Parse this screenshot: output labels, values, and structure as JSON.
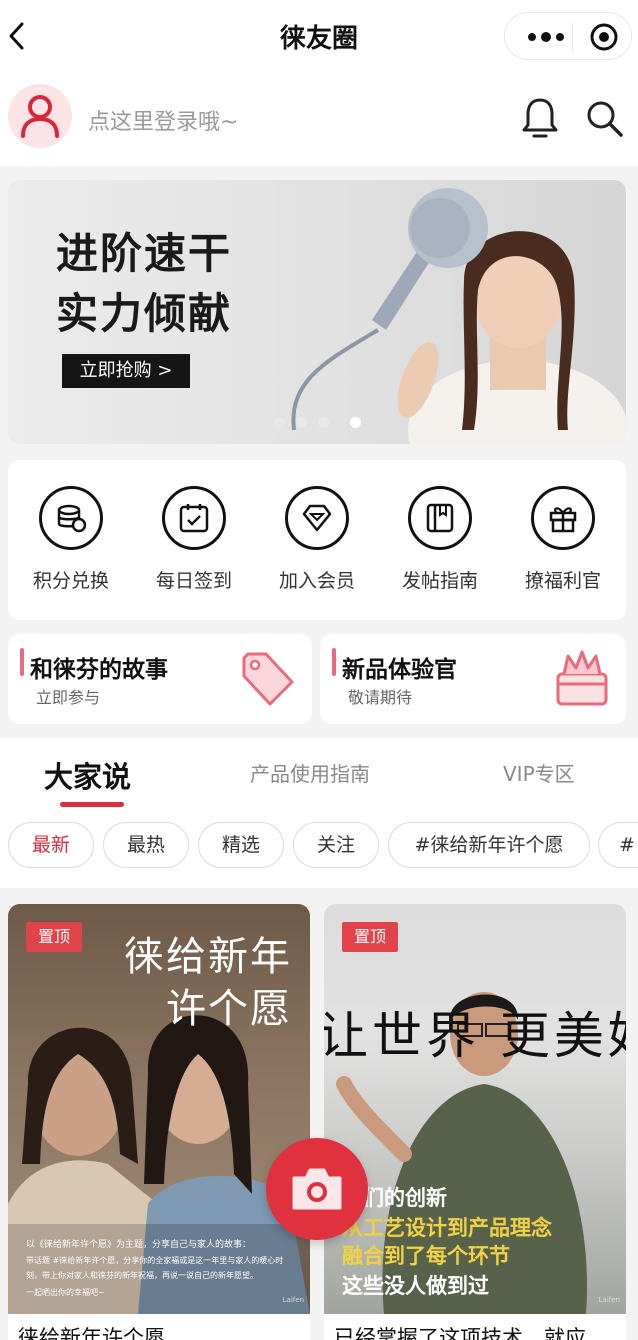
{
  "nav": {
    "title": "徕友圈",
    "back_icon": "back-arrow-icon",
    "more_icon": "more-dots-icon",
    "target_icon": "target-icon"
  },
  "user": {
    "login_prompt": "点这里登录哦~",
    "avatar_icon": "user-icon",
    "bell_icon": "bell-icon",
    "search_icon": "search-icon"
  },
  "banner": {
    "line1": "进阶速干",
    "line2": "实力倾献",
    "cta": "立即抢购 >",
    "slide_count": 4,
    "active_slide": 4
  },
  "quick_actions": [
    {
      "label": "积分兑换",
      "icon": "coins-icon"
    },
    {
      "label": "每日签到",
      "icon": "checkin-calendar-icon"
    },
    {
      "label": "加入会员",
      "icon": "diamond-icon"
    },
    {
      "label": "发帖指南",
      "icon": "book-icon"
    },
    {
      "label": "撩福利官",
      "icon": "gift-icon"
    }
  ],
  "promo_cards": [
    {
      "title": "和徕芬的故事",
      "subtitle": "立即参与",
      "icon": "tag-icon"
    },
    {
      "title": "新品体验官",
      "subtitle": "敬请期待",
      "icon": "gift-box-icon"
    }
  ],
  "tabs": [
    {
      "label": "大家说",
      "active": true
    },
    {
      "label": "产品使用指南",
      "active": false
    },
    {
      "label": "VIP专区",
      "active": false
    }
  ],
  "chips": [
    {
      "label": "最新",
      "active": true
    },
    {
      "label": "最热",
      "active": false
    },
    {
      "label": "精选",
      "active": false
    },
    {
      "label": "关注",
      "active": false
    },
    {
      "label": "#徕给新年许个愿",
      "active": false
    },
    {
      "label": "#",
      "active": false
    }
  ],
  "posts": [
    {
      "pin": "置顶",
      "headline_1": "徕给新年",
      "headline_2": "许个愿",
      "desc_1": "以《徕给新年许个愿》为主题，分享自己与家人的故事：",
      "desc_2": "带话题 #徕给新年许个愿，分享你的全家福或是这一年里与家人的暖心时",
      "desc_3": "刻，带上你对家人和徕芬的新年祝福，再说一说自己的新年愿望。",
      "desc_4": "一起晒出你的幸福吧~",
      "brand": "Laifen",
      "caption": "徕给新年许个愿"
    },
    {
      "pin": "置顶",
      "headline": "让世界 更美好",
      "line_1": "我们的创新",
      "line_2": "从工艺设计到产品理念",
      "line_3": "融合到了每个环节",
      "line_4": "这些没人做到过",
      "brand": "Laifen",
      "caption": "已经掌握了这项技术，就应"
    }
  ],
  "fab": {
    "icon": "camera-icon"
  },
  "colors": {
    "accent": "#d32f3d",
    "pin": "#e0444a",
    "highlight": "#f2d245",
    "avatar_bg": "#fbe3e6"
  }
}
